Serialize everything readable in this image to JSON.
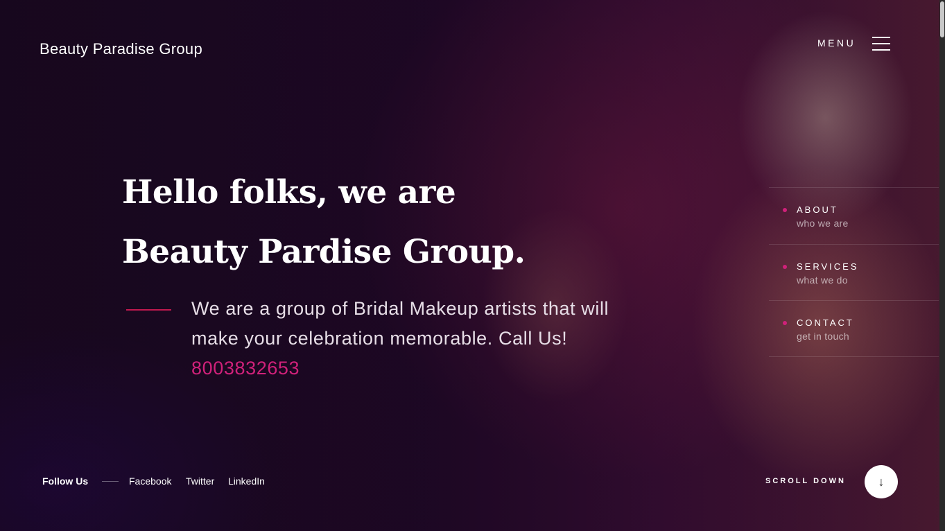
{
  "header": {
    "brand": "Beauty Paradise Group",
    "menu_label": "MENU",
    "menu_icon": "hamburger-icon"
  },
  "hero": {
    "line1": "Hello folks, we are",
    "line2": "Beauty Pardise Group.",
    "description_part1": "We are a group of Bridal Makeup artists that will make your celebration memorable.",
    "description_part2": "Call Us!",
    "phone": "8003832653"
  },
  "side_nav": {
    "items": [
      {
        "title": "ABOUT",
        "subtitle": "who we are"
      },
      {
        "title": "SERVICES",
        "subtitle": "what we do"
      },
      {
        "title": "CONTACT",
        "subtitle": "get in touch"
      }
    ]
  },
  "footer": {
    "follow_label": "Follow Us",
    "social": [
      "Facebook",
      "Twitter",
      "LinkedIn"
    ],
    "scroll_label": "SCROLL DOWN",
    "scroll_icon": "arrow-down-icon"
  },
  "colors": {
    "accent": "#d0217a",
    "accent_line": "#c0194f",
    "background": "#1a0a22"
  }
}
